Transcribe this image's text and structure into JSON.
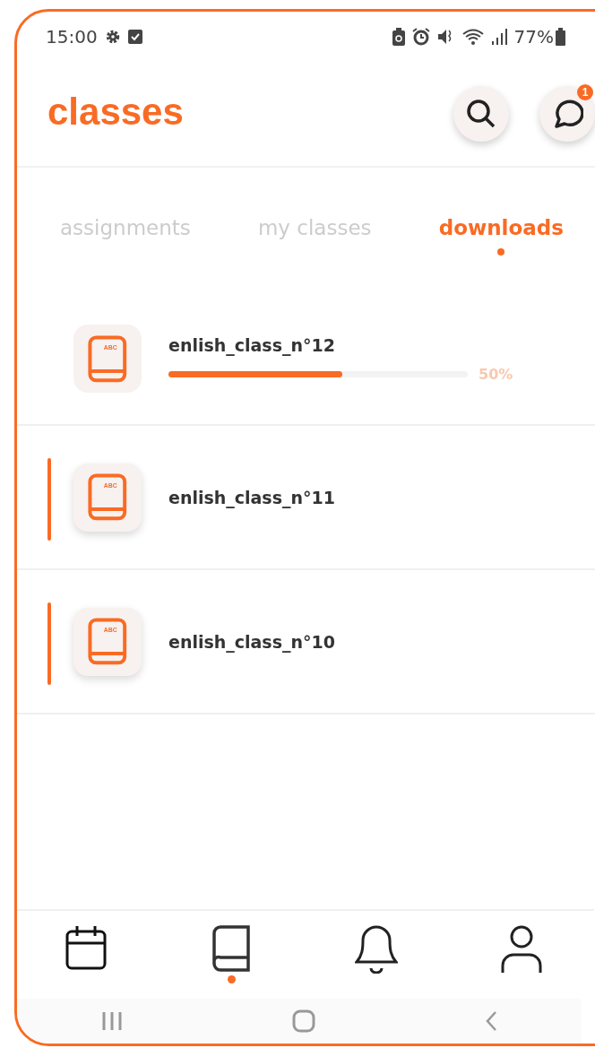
{
  "status_bar": {
    "time": "15:00",
    "battery": "77%"
  },
  "header": {
    "title": "classes",
    "notification_badge": "1"
  },
  "tabs": [
    {
      "label": "assignments",
      "selected": false
    },
    {
      "label": "my classes",
      "selected": false
    },
    {
      "label": "downloads",
      "selected": true
    }
  ],
  "downloads": [
    {
      "kind": "downloading",
      "icon_label": "ABC",
      "name": "enlish_class_n°12",
      "level": 0.58,
      "reading": "50%"
    },
    {
      "kind": "downloaded",
      "icon_label": "ABC",
      "name": "enlish_class_n°11"
    },
    {
      "kind": "downloaded",
      "icon_label": "ABC",
      "name": "enlish_class_n°10"
    }
  ],
  "bottom_nav": [
    {
      "kind": "calendar",
      "selected": false
    },
    {
      "kind": "book",
      "selected": true
    },
    {
      "kind": "bell",
      "selected": false
    },
    {
      "kind": "person",
      "selected": false
    }
  ]
}
